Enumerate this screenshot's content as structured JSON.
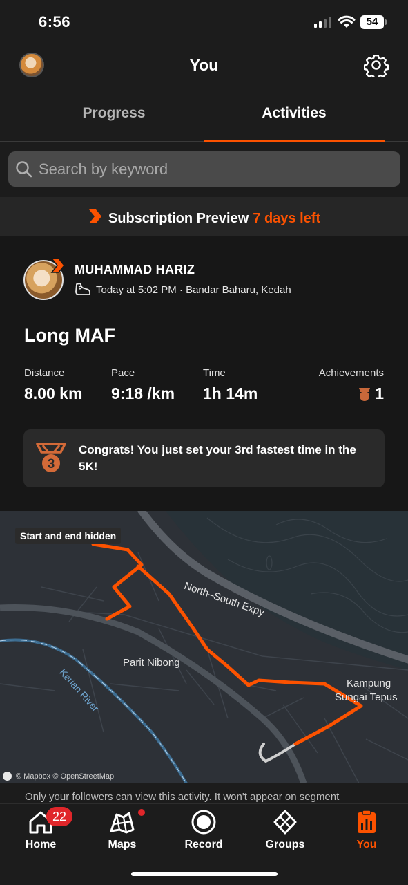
{
  "status_bar": {
    "time": "6:56",
    "battery": "54"
  },
  "header": {
    "title": "You",
    "avatar_icon": "profile-avatar",
    "settings_icon": "gear-icon"
  },
  "tabs": [
    {
      "label": "Progress",
      "active": false
    },
    {
      "label": "Activities",
      "active": true
    }
  ],
  "search": {
    "placeholder": "Search by keyword",
    "value": ""
  },
  "subscription": {
    "label": "Subscription Preview",
    "days_left": "7 days left"
  },
  "activity": {
    "athlete_name": "MUHAMMAD HARIZ",
    "meta": "Today at 5:02 PM · Bandar Baharu, Kedah",
    "title": "Long MAF",
    "stats": [
      {
        "label": "Distance",
        "value": "8.00 km"
      },
      {
        "label": "Pace",
        "value": "9:18 /km"
      },
      {
        "label": "Time",
        "value": "1h 14m"
      }
    ],
    "achievements": {
      "label": "Achievements",
      "value": "1"
    },
    "congrats": "Congrats! You just set your 3rd fastest time in the 5K!"
  },
  "map": {
    "privacy_pill": "Start and end hidden",
    "labels": {
      "expressway": "North–South Expy",
      "town1": "Parit Nibong",
      "town2_line1": "Kampung",
      "town2_line2": "Sungai Tepus",
      "river": "Kerian River"
    },
    "attribution": "© Mapbox © OpenStreetMap"
  },
  "privacy_note": "Only your followers can view this activity. It won't appear on segment",
  "tabbar": {
    "items": [
      {
        "label": "Home",
        "badge": "22",
        "icon": "home-icon"
      },
      {
        "label": "Maps",
        "icon": "maps-icon"
      },
      {
        "label": "Record",
        "icon": "record-icon"
      },
      {
        "label": "Groups",
        "icon": "groups-icon"
      },
      {
        "label": "You",
        "icon": "you-icon",
        "active": true
      }
    ]
  },
  "colors": {
    "accent": "#fc5200",
    "background": "#1c1c1c",
    "badge": "#e0262a"
  }
}
